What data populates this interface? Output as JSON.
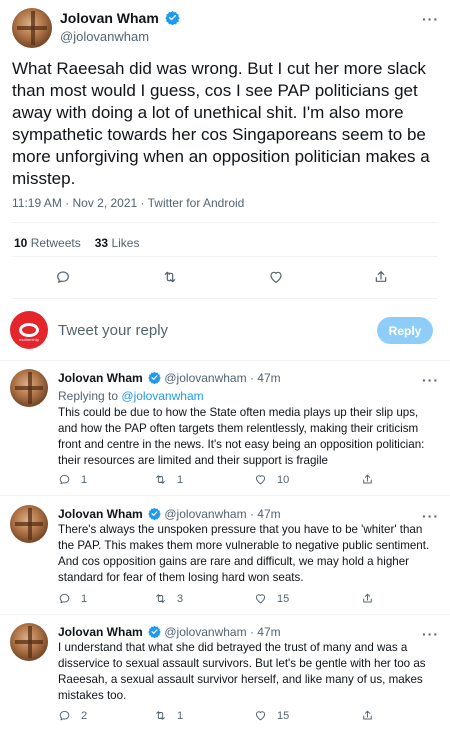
{
  "main_tweet": {
    "name": "Jolovan Wham",
    "handle": "@jolovanwham",
    "text": "What Raeesah did was wrong. But I cut her more slack than most would I guess, cos I see PAP politicians get away with doing a lot of unethical shit. I'm also more sympathetic towards her cos Singaporeans seem to be more unforgiving when an opposition politician makes a misstep.",
    "meta": "11:19 AM · Nov 2, 2021 · Twitter for Android",
    "retweets_count": "10",
    "retweets_label": "Retweets",
    "likes_count": "33",
    "likes_label": "Likes"
  },
  "composer": {
    "placeholder": "Tweet your reply",
    "button_label": "Reply",
    "avatar_text": "mothership"
  },
  "replies": [
    {
      "name": "Jolovan Wham",
      "handle": "@jolovanwham",
      "separator": "·",
      "time": "47m",
      "replying_prefix": "Replying to",
      "replying_to": "@jolovanwham",
      "text": "This could be due to how the State often media plays up their slip ups, and how the PAP often targets them relentlessly, making their criticism front and centre in the news. It's not easy being an opposition politician: their resources are limited and their support is fragile",
      "replies": "1",
      "retweets": "1",
      "likes": "10"
    },
    {
      "name": "Jolovan Wham",
      "handle": "@jolovanwham",
      "separator": "·",
      "time": "47m",
      "text": "There's always the unspoken pressure that you have to be 'whiter' than the PAP. This makes them more vulnerable to negative public sentiment. And cos opposition gains are rare and difficult, we may hold a higher standard for fear of them losing hard won seats.",
      "replies": "1",
      "retweets": "3",
      "likes": "15"
    },
    {
      "name": "Jolovan Wham",
      "handle": "@jolovanwham",
      "separator": "·",
      "time": "47m",
      "text": "I understand that what she did betrayed the trust of many and was a disservice to sexual assault survivors. But let's be gentle with her too as Raeesah, a sexual assault survivor herself, and like many of us, makes mistakes too.",
      "replies": "2",
      "retweets": "1",
      "likes": "15"
    }
  ],
  "icons": {
    "reply": "comment-icon",
    "retweet": "retweet-icon",
    "like": "heart-icon",
    "share": "share-icon",
    "verified": "verified-badge-icon",
    "more": "more-icon"
  },
  "colors": {
    "accent": "#1d9bf0",
    "reply_button_disabled": "#8ecdf8",
    "secondary_text": "#536471",
    "divider": "#eff3f4",
    "composer_avatar": "#e5242c"
  }
}
